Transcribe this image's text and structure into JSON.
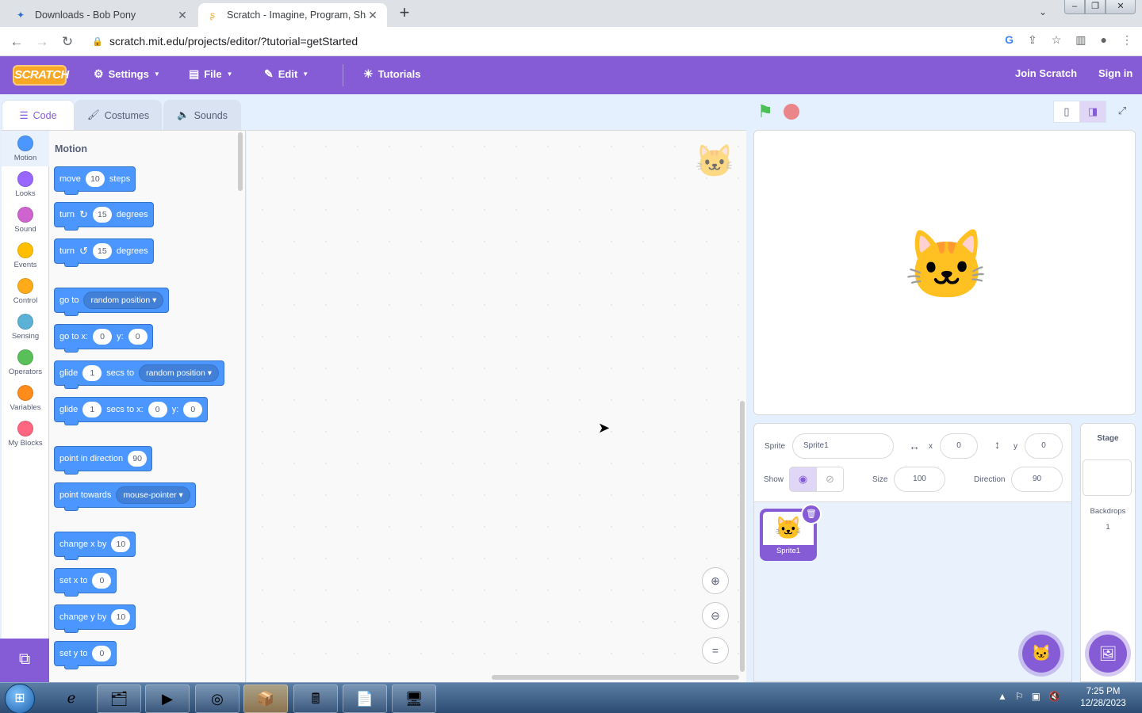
{
  "browser": {
    "tabs": [
      {
        "title": "Downloads - Bob Pony",
        "icon": "bob-pony-favicon"
      },
      {
        "title": "Scratch - Imagine, Program, Sha",
        "icon": "scratch-favicon"
      }
    ],
    "url": "scratch.mit.edu/projects/editor/?tutorial=getStarted"
  },
  "menubar": {
    "logo": "SCRATCH",
    "settings": "Settings",
    "file": "File",
    "edit": "Edit",
    "tutorials": "Tutorials",
    "join": "Join Scratch",
    "signin": "Sign in"
  },
  "editor_tabs": {
    "code": "Code",
    "costumes": "Costumes",
    "sounds": "Sounds"
  },
  "categories": [
    {
      "label": "Motion",
      "color": "#4c97ff"
    },
    {
      "label": "Looks",
      "color": "#9966ff"
    },
    {
      "label": "Sound",
      "color": "#cf63cf"
    },
    {
      "label": "Events",
      "color": "#ffbf00"
    },
    {
      "label": "Control",
      "color": "#ffab19"
    },
    {
      "label": "Sensing",
      "color": "#5cb1d6"
    },
    {
      "label": "Operators",
      "color": "#59c059"
    },
    {
      "label": "Variables",
      "color": "#ff8c1a"
    },
    {
      "label": "My Blocks",
      "color": "#ff6680"
    }
  ],
  "palette": {
    "title": "Motion",
    "blocks": {
      "move": {
        "a": "move",
        "v": "10",
        "b": "steps"
      },
      "turn_right": {
        "a": "turn",
        "v": "15",
        "b": "degrees"
      },
      "turn_left": {
        "a": "turn",
        "v": "15",
        "b": "degrees"
      },
      "goto": {
        "a": "go to",
        "d": "random position"
      },
      "gotoxy": {
        "a": "go to x:",
        "x": "0",
        "b": "y:",
        "y": "0"
      },
      "glide_to": {
        "a": "glide",
        "v": "1",
        "b": "secs to",
        "d": "random position"
      },
      "glide_xy": {
        "a": "glide",
        "v": "1",
        "b": "secs to x:",
        "x": "0",
        "c": "y:",
        "y": "0"
      },
      "point_dir": {
        "a": "point in direction",
        "v": "90"
      },
      "point_towards": {
        "a": "point towards",
        "d": "mouse-pointer"
      },
      "change_x": {
        "a": "change x by",
        "v": "10"
      },
      "set_x": {
        "a": "set x to",
        "v": "0"
      },
      "change_y": {
        "a": "change y by",
        "v": "10"
      },
      "set_y": {
        "a": "set y to",
        "v": "0"
      }
    }
  },
  "sprite_info": {
    "sprite_label": "Sprite",
    "sprite_name": "Sprite1",
    "x_label": "x",
    "x": "0",
    "y_label": "y",
    "y": "0",
    "show_label": "Show",
    "size_label": "Size",
    "size": "100",
    "direction_label": "Direction",
    "direction": "90"
  },
  "sprites": [
    {
      "name": "Sprite1"
    }
  ],
  "stage_pane": {
    "title": "Stage",
    "backdrops_label": "Backdrops",
    "backdrops_count": "1"
  },
  "taskbar": {
    "time": "7:25 PM",
    "date": "12/28/2023"
  }
}
